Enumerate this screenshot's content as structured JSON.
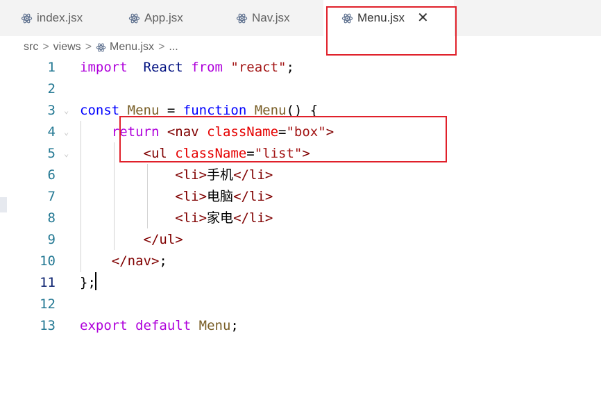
{
  "tabs": [
    {
      "label": "index.jsx",
      "icon": "react-icon"
    },
    {
      "label": "App.jsx",
      "icon": "react-icon"
    },
    {
      "label": "Nav.jsx",
      "icon": "react-icon"
    },
    {
      "label": "Menu.jsx",
      "icon": "react-icon",
      "active": true,
      "close": "✕"
    }
  ],
  "breadcrumb": {
    "parts": [
      "src",
      "views",
      "Menu.jsx",
      "..."
    ],
    "separator": ">"
  },
  "editor": {
    "current_line": 11,
    "lines": [
      {
        "n": "1",
        "tokens": [
          [
            "kw2",
            "import"
          ],
          [
            "",
            "  "
          ],
          [
            "ident",
            "React"
          ],
          [
            "",
            " "
          ],
          [
            "kw2",
            "from"
          ],
          [
            "",
            " "
          ],
          [
            "str",
            "\"react\""
          ],
          [
            "",
            ";"
          ]
        ]
      },
      {
        "n": "2",
        "tokens": []
      },
      {
        "n": "3",
        "tokens": [
          [
            "kw",
            "const"
          ],
          [
            "",
            " "
          ],
          [
            "fn",
            "Menu"
          ],
          [
            "",
            " = "
          ],
          [
            "kw",
            "function"
          ],
          [
            "",
            " "
          ],
          [
            "fn",
            "Menu"
          ],
          [
            "",
            "() {"
          ]
        ]
      },
      {
        "n": "4",
        "tokens": [
          [
            "",
            "    "
          ],
          [
            "kw2",
            "return"
          ],
          [
            "",
            " "
          ],
          [
            "tag",
            "<nav"
          ],
          [
            "",
            " "
          ],
          [
            "attr",
            "className"
          ],
          [
            "",
            "="
          ],
          [
            "str",
            "\"box\""
          ],
          [
            "tag",
            ">"
          ]
        ]
      },
      {
        "n": "5",
        "tokens": [
          [
            "",
            "        "
          ],
          [
            "tag",
            "<ul"
          ],
          [
            "",
            " "
          ],
          [
            "attr",
            "className"
          ],
          [
            "",
            "="
          ],
          [
            "str",
            "\"list\""
          ],
          [
            "tag",
            ">"
          ]
        ]
      },
      {
        "n": "6",
        "tokens": [
          [
            "",
            "            "
          ],
          [
            "tag",
            "<li>"
          ],
          [
            "",
            "手机"
          ],
          [
            "tag",
            "</li>"
          ]
        ]
      },
      {
        "n": "7",
        "tokens": [
          [
            "",
            "            "
          ],
          [
            "tag",
            "<li>"
          ],
          [
            "",
            "电脑"
          ],
          [
            "tag",
            "</li>"
          ]
        ]
      },
      {
        "n": "8",
        "tokens": [
          [
            "",
            "            "
          ],
          [
            "tag",
            "<li>"
          ],
          [
            "",
            "家电"
          ],
          [
            "tag",
            "</li>"
          ]
        ]
      },
      {
        "n": "9",
        "tokens": [
          [
            "",
            "        "
          ],
          [
            "tag",
            "</ul>"
          ]
        ]
      },
      {
        "n": "10",
        "tokens": [
          [
            "",
            "    "
          ],
          [
            "tag",
            "</nav>"
          ],
          [
            "",
            ";"
          ]
        ]
      },
      {
        "n": "11",
        "tokens": [
          [
            "",
            "};"
          ]
        ]
      },
      {
        "n": "12",
        "tokens": []
      },
      {
        "n": "13",
        "tokens": [
          [
            "kw2",
            "export"
          ],
          [
            "",
            " "
          ],
          [
            "kw2",
            "default"
          ],
          [
            "",
            " "
          ],
          [
            "fn",
            "Menu"
          ],
          [
            "",
            ";"
          ]
        ]
      }
    ]
  },
  "colors": {
    "highlight_box": "#e0202a",
    "line_number": "#237893"
  }
}
